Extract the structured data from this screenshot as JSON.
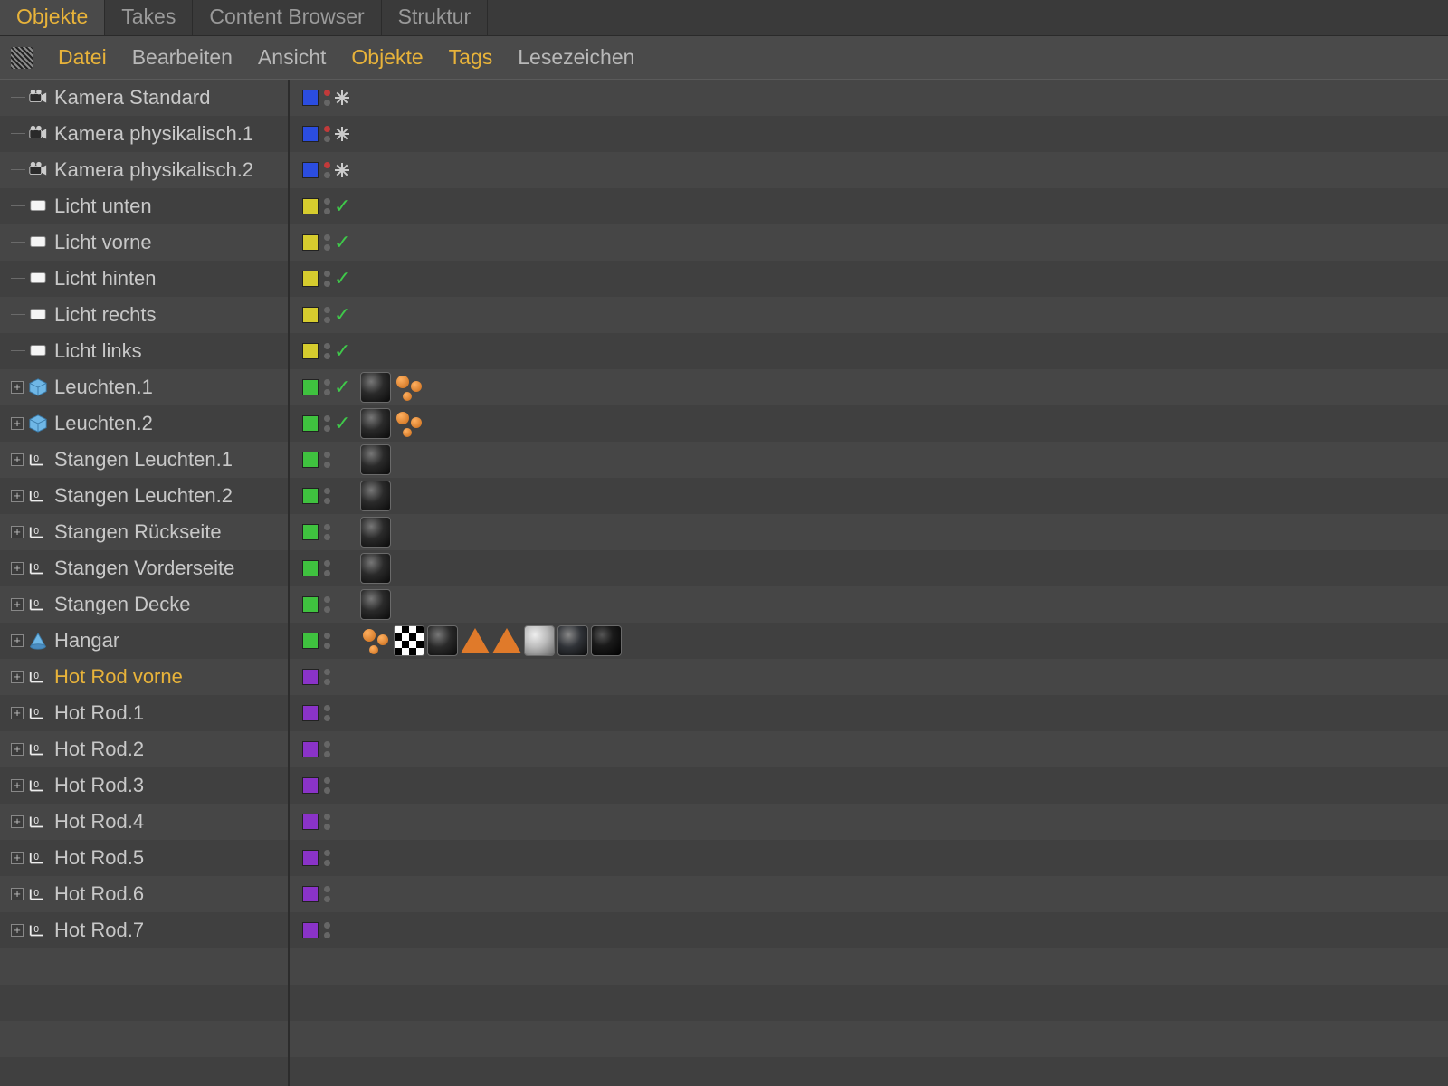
{
  "tabs": {
    "objekte": "Objekte",
    "takes": "Takes",
    "content_browser": "Content Browser",
    "struktur": "Struktur"
  },
  "menu": {
    "datei": "Datei",
    "bearbeiten": "Bearbeiten",
    "ansicht": "Ansicht",
    "objekte": "Objekte",
    "tags": "Tags",
    "lesezeichen": "Lesezeichen"
  },
  "colors": {
    "blue": "#2b4de0",
    "yellow": "#d6cc2e",
    "green": "#3fc23f",
    "purple": "#8a33c8",
    "accent": "#e8b33a"
  },
  "objects": [
    {
      "name": "Kamera Standard",
      "icon": "camera",
      "expand": false,
      "layer": "blue",
      "dots": "red",
      "ext": "xarrows",
      "tags": []
    },
    {
      "name": "Kamera physikalisch.1",
      "icon": "camera",
      "expand": false,
      "layer": "blue",
      "dots": "red",
      "ext": "xarrows",
      "tags": []
    },
    {
      "name": "Kamera physikalisch.2",
      "icon": "camera",
      "expand": false,
      "layer": "blue",
      "dots": "red",
      "ext": "xarrows",
      "tags": []
    },
    {
      "name": "Licht unten",
      "icon": "light",
      "expand": false,
      "layer": "yellow",
      "dots": "grey",
      "ext": "check",
      "tags": []
    },
    {
      "name": "Licht vorne",
      "icon": "light",
      "expand": false,
      "layer": "yellow",
      "dots": "grey",
      "ext": "check",
      "tags": []
    },
    {
      "name": "Licht hinten",
      "icon": "light",
      "expand": false,
      "layer": "yellow",
      "dots": "grey",
      "ext": "check",
      "tags": []
    },
    {
      "name": "Licht rechts",
      "icon": "light",
      "expand": false,
      "layer": "yellow",
      "dots": "grey",
      "ext": "check",
      "tags": []
    },
    {
      "name": "Licht links",
      "icon": "light",
      "expand": false,
      "layer": "yellow",
      "dots": "grey",
      "ext": "check",
      "tags": []
    },
    {
      "name": "Leuchten.1",
      "icon": "cube",
      "expand": true,
      "layer": "green",
      "dots": "grey",
      "ext": "check",
      "tags": [
        "sphere",
        "orangeballs"
      ]
    },
    {
      "name": "Leuchten.2",
      "icon": "cube",
      "expand": true,
      "layer": "green",
      "dots": "grey",
      "ext": "check",
      "tags": [
        "sphere",
        "orangeballs"
      ]
    },
    {
      "name": "Stangen Leuchten.1",
      "icon": "null",
      "expand": true,
      "layer": "green",
      "dots": "grey",
      "ext": "",
      "tags": [
        "sphere"
      ]
    },
    {
      "name": "Stangen Leuchten.2",
      "icon": "null",
      "expand": true,
      "layer": "green",
      "dots": "grey",
      "ext": "",
      "tags": [
        "sphere"
      ]
    },
    {
      "name": "Stangen Rückseite",
      "icon": "null",
      "expand": true,
      "layer": "green",
      "dots": "grey",
      "ext": "",
      "tags": [
        "sphere"
      ]
    },
    {
      "name": "Stangen Vorderseite",
      "icon": "null",
      "expand": true,
      "layer": "green",
      "dots": "grey",
      "ext": "",
      "tags": [
        "sphere"
      ]
    },
    {
      "name": "Stangen Decke",
      "icon": "null",
      "expand": true,
      "layer": "green",
      "dots": "grey",
      "ext": "",
      "tags": [
        "sphere"
      ]
    },
    {
      "name": "Hangar",
      "icon": "cone",
      "expand": true,
      "layer": "green",
      "dots": "grey",
      "ext": "",
      "tags": [
        "orangeballs",
        "checker",
        "sphere",
        "orangetri",
        "orangetri",
        "sphere-light",
        "sphere-purpleish",
        "sphere-dark"
      ]
    },
    {
      "name": "Hot Rod vorne",
      "icon": "null",
      "expand": true,
      "layer": "purple",
      "dots": "grey",
      "ext": "",
      "tags": [],
      "selected": true
    },
    {
      "name": "Hot Rod.1",
      "icon": "null",
      "expand": true,
      "layer": "purple",
      "dots": "grey",
      "ext": "",
      "tags": []
    },
    {
      "name": "Hot Rod.2",
      "icon": "null",
      "expand": true,
      "layer": "purple",
      "dots": "grey",
      "ext": "",
      "tags": []
    },
    {
      "name": "Hot Rod.3",
      "icon": "null",
      "expand": true,
      "layer": "purple",
      "dots": "grey",
      "ext": "",
      "tags": []
    },
    {
      "name": "Hot Rod.4",
      "icon": "null",
      "expand": true,
      "layer": "purple",
      "dots": "grey",
      "ext": "",
      "tags": []
    },
    {
      "name": "Hot Rod.5",
      "icon": "null",
      "expand": true,
      "layer": "purple",
      "dots": "grey",
      "ext": "",
      "tags": []
    },
    {
      "name": "Hot Rod.6",
      "icon": "null",
      "expand": true,
      "layer": "purple",
      "dots": "grey",
      "ext": "",
      "tags": []
    },
    {
      "name": "Hot Rod.7",
      "icon": "null",
      "expand": true,
      "layer": "purple",
      "dots": "grey",
      "ext": "",
      "tags": []
    }
  ]
}
